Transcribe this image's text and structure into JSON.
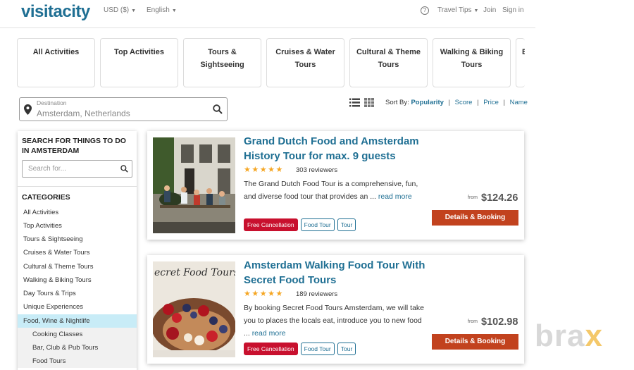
{
  "header": {
    "logo": "visitacity",
    "currency": "USD ($)",
    "language": "English",
    "help_icon": "question-circle-icon",
    "travel_tips": "Travel Tips",
    "join": "Join",
    "sign_in": "Sign in"
  },
  "categories": [
    "All Activities",
    "Top Activities",
    "Tours &\nSightseeing",
    "Cruises & Water\nTours",
    "Cultural & Theme\nTours",
    "Walking & Biking\nTours",
    "E"
  ],
  "destination": {
    "label": "Destination",
    "value": "Amsterdam, Netherlands",
    "pin_icon": "map-pin-icon",
    "search_icon": "search-icon"
  },
  "view": {
    "list_icon": "list-view-icon",
    "grid_icon": "grid-view-icon"
  },
  "sort": {
    "label": "Sort By:",
    "options": [
      "Popularity",
      "Score",
      "Price",
      "Name"
    ],
    "selected": "Popularity"
  },
  "sidebar": {
    "title": "SEARCH FOR THINGS TO DO IN AMSTERDAM",
    "search_placeholder": "Search for...",
    "categories_title": "CATEGORIES",
    "items": [
      {
        "label": "All Activities"
      },
      {
        "label": "Top Activities"
      },
      {
        "label": "Tours & Sightseeing"
      },
      {
        "label": "Cruises & Water Tours"
      },
      {
        "label": "Cultural & Theme Tours"
      },
      {
        "label": "Walking & Biking Tours"
      },
      {
        "label": "Day Tours & Trips"
      },
      {
        "label": "Unique Experiences"
      },
      {
        "label": "Food, Wine & Nightlife"
      },
      {
        "label": "Cooking Classes"
      },
      {
        "label": "Bar, Club & Pub Tours"
      },
      {
        "label": "Food Tours"
      }
    ]
  },
  "listings": [
    {
      "title": "Grand Dutch Food and Amsterdam History Tour for max. 9 guests",
      "stars": "★★★★★",
      "reviews": "303 reviewers",
      "desc": "The Grand Dutch Food Tour is a comprehensive, fun, and diverse food tour that provides an ...",
      "read_more": "read more",
      "tags": [
        "Free Cancellation",
        "Food Tour",
        "Tour"
      ],
      "from": "from",
      "price": "$124.26",
      "button": "Details & Booking"
    },
    {
      "title": "Amsterdam Walking Food Tour With Secret Food Tours",
      "stars": "★★★★★",
      "reviews": "189 reviewers",
      "desc": "By booking Secret Food Tours Amsterdam, we will take you to places the locals eat, introduce you to new food ...",
      "read_more": "read more",
      "tags": [
        "Free Cancellation",
        "Food Tour",
        "Tour"
      ],
      "from": "from",
      "price": "$102.98",
      "button": "Details & Booking",
      "photo_text": "ecret Food Tours"
    }
  ],
  "watermark": {
    "left": "bra",
    "accent": "x"
  },
  "colors": {
    "brand": "#1f6f93",
    "button": "#c2421e",
    "free_tag": "#c8102e",
    "active_cat": "#c8ecf7",
    "stars": "#f5a623"
  }
}
